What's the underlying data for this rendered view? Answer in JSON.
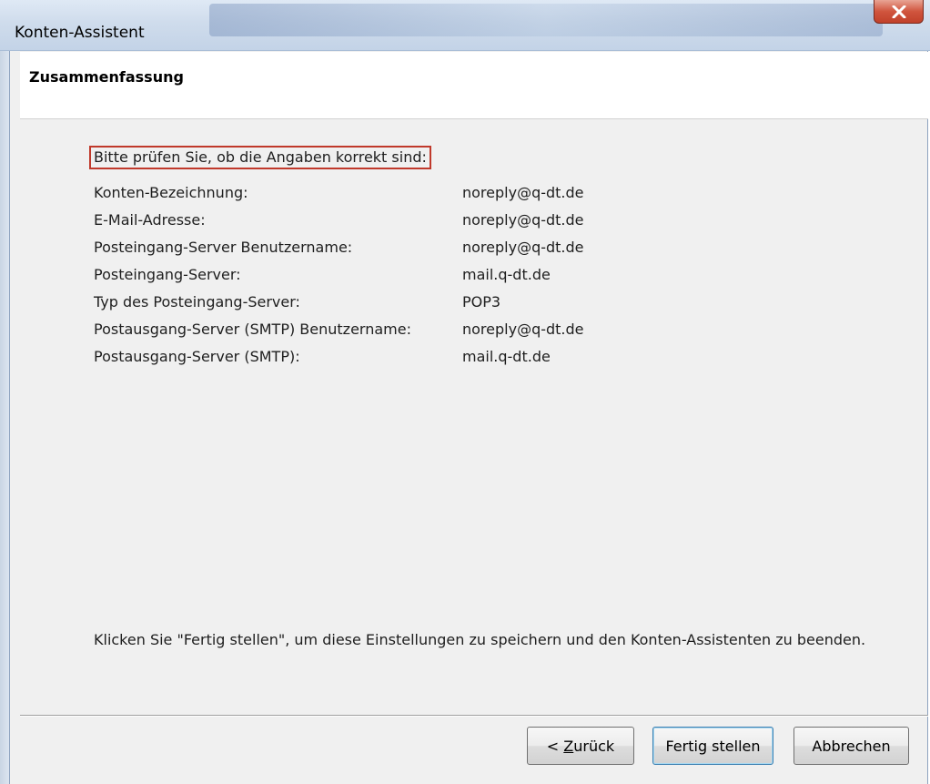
{
  "window": {
    "title": "Konten-Assistent",
    "close_icon": "close-x-icon"
  },
  "header": {
    "title": "Zusammenfassung"
  },
  "summary": {
    "prompt": "Bitte prüfen Sie, ob die Angaben korrekt sind:",
    "rows": [
      {
        "label": "Konten-Bezeichnung:",
        "value": "noreply@q-dt.de"
      },
      {
        "label": "E-Mail-Adresse:",
        "value": "noreply@q-dt.de"
      },
      {
        "label": "Posteingang-Server Benutzername:",
        "value": "noreply@q-dt.de"
      },
      {
        "label": "Posteingang-Server:",
        "value": "mail.q-dt.de"
      },
      {
        "label": "Typ des Posteingang-Server:",
        "value": "POP3"
      },
      {
        "label": "Postausgang-Server (SMTP) Benutzername:",
        "value": "noreply@q-dt.de"
      },
      {
        "label": "Postausgang-Server (SMTP):",
        "value": "mail.q-dt.de"
      }
    ],
    "footer_note": "Klicken Sie \"Fertig stellen\", um diese Einstellungen zu speichern und den Konten-Assistenten zu beenden."
  },
  "buttons": {
    "back_prefix": "< ",
    "back_mnemonic": "Z",
    "back_rest": "urück",
    "finish": "Fertig stellen",
    "cancel": "Abbrechen"
  },
  "colors": {
    "highlight_border": "#c0392b",
    "close_button": "#c1412a"
  }
}
